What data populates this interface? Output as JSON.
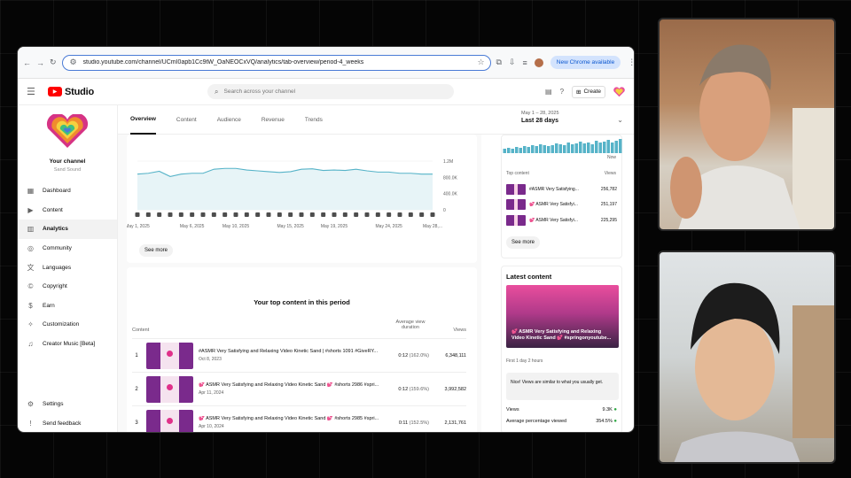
{
  "browser": {
    "url": "studio.youtube.com/channel/UCmI0apb1Cc9tW_OaNEOCxVQ/analytics/tab-overview/period-4_weeks",
    "new_chrome_label": "New Chrome available"
  },
  "header": {
    "logo_text": "Studio",
    "search_placeholder": "Search across your channel",
    "create_label": "Create"
  },
  "channel": {
    "label": "Your channel",
    "name": "Sand Sound"
  },
  "sidebar": {
    "items": [
      {
        "label": "Dashboard",
        "icon": "dashboard-icon"
      },
      {
        "label": "Content",
        "icon": "content-icon"
      },
      {
        "label": "Analytics",
        "icon": "analytics-icon"
      },
      {
        "label": "Community",
        "icon": "community-icon"
      },
      {
        "label": "Languages",
        "icon": "languages-icon"
      },
      {
        "label": "Copyright",
        "icon": "copyright-icon"
      },
      {
        "label": "Earn",
        "icon": "earn-icon"
      },
      {
        "label": "Customization",
        "icon": "customization-icon"
      },
      {
        "label": "Creator Music [Beta]",
        "icon": "creator-music-icon"
      }
    ],
    "bottom": [
      {
        "label": "Settings",
        "icon": "gear-icon"
      },
      {
        "label": "Send feedback",
        "icon": "feedback-icon"
      }
    ]
  },
  "tabs": [
    "Overview",
    "Content",
    "Audience",
    "Revenue",
    "Trends"
  ],
  "date_range": {
    "range": "May 1 – 28, 2025",
    "label": "Last 28 days"
  },
  "main_chart": {
    "y_ticks": [
      "1.2M",
      "800.0K",
      "400.0K",
      "0"
    ],
    "x_ticks": [
      "May 1, 2025",
      "May 6, 2025",
      "May 10, 2025",
      "May 15, 2025",
      "May 19, 2025",
      "May 24, 2025",
      "May 28,..."
    ],
    "see_more": "See more"
  },
  "chart_data": {
    "type": "area",
    "x": [
      "May 1",
      "May 2",
      "May 3",
      "May 4",
      "May 5",
      "May 6",
      "May 7",
      "May 8",
      "May 9",
      "May 10",
      "May 11",
      "May 12",
      "May 13",
      "May 14",
      "May 15",
      "May 16",
      "May 17",
      "May 18",
      "May 19",
      "May 20",
      "May 21",
      "May 22",
      "May 23",
      "May 24",
      "May 25",
      "May 26",
      "May 27",
      "May 28"
    ],
    "values": [
      880000,
      900000,
      950000,
      820000,
      880000,
      900000,
      900000,
      1000000,
      1020000,
      1020000,
      980000,
      960000,
      940000,
      920000,
      940000,
      1000000,
      1010000,
      970000,
      980000,
      970000,
      1000000,
      960000,
      930000,
      930000,
      900000,
      900000,
      880000,
      880000
    ],
    "ylim": [
      0,
      1200000
    ]
  },
  "top_content": {
    "title": "Your top content in this period",
    "headers": {
      "content": "Content",
      "duration": "Average view duration",
      "views": "Views"
    },
    "rows": [
      {
        "idx": "1",
        "title": "#ASMR Very Satisfying and Relaxing Video Kinetic Sand | #shorts 1091 #GiveRY...",
        "date": "Oct 8, 2023",
        "duration": "0:12",
        "pct": "(162.0%)",
        "views": "6,348,111"
      },
      {
        "idx": "2",
        "title": "💕 ASMR Very Satisfying and Relaxing Video Kinetic Sand 💕 #shorts 2986 #spri...",
        "date": "Apr 11, 2024",
        "duration": "0:12",
        "pct": "(159.6%)",
        "views": "3,992,582"
      },
      {
        "idx": "3",
        "title": "💕 ASMR Very Satisfying and Relaxing Video Kinetic Sand 💕 #shorts 2985 #spri...",
        "date": "Apr 10, 2024",
        "duration": "0:11",
        "pct": "(152.5%)",
        "views": "2,131,761"
      }
    ]
  },
  "realtime": {
    "now_label": "Now",
    "top_content_label": "Top content",
    "views_label": "Views",
    "items": [
      {
        "title": "#ASMR Very Satisfying...",
        "views": "256,782"
      },
      {
        "title": "💕 ASMR Very Satisfyi...",
        "views": "251,197"
      },
      {
        "title": "💕 ASMR Very Satisfyi...",
        "views": "225,295"
      }
    ],
    "see_more": "See more"
  },
  "latest": {
    "title": "Latest content",
    "caption": "💕 ASMR Very Satisfying and Relaxing Video Kinetic Sand 💕 #springonyoutube...",
    "time": "First 1 day 2 hours",
    "note": "Nice! Views are similar to what you usually get.",
    "views_label": "Views",
    "views_value": "9.3K",
    "pct_label": "Average percentage viewed",
    "pct_value": "354.5%"
  },
  "colors": {
    "accent": "#065fd4",
    "chart_line": "#56b3c8",
    "chart_fill": "#e7f4f7",
    "yt_red": "#ff0000",
    "green": "#2ba640"
  }
}
